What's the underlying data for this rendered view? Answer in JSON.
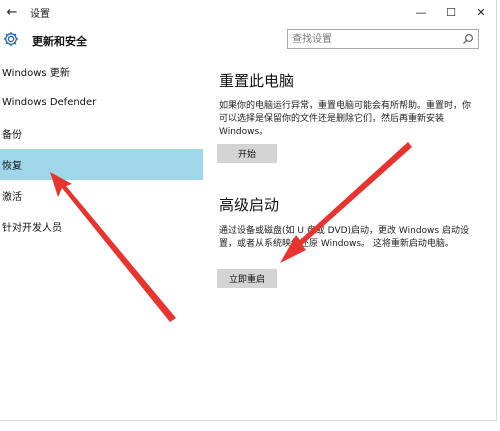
{
  "window": {
    "title": "设置",
    "back_glyph": "←",
    "minimize_glyph": "—",
    "maximize_glyph": "☐",
    "close_glyph": "✕"
  },
  "header": {
    "icon": "gear-icon",
    "title": "更新和安全"
  },
  "search": {
    "placeholder": "查找设置",
    "icon": "search-icon"
  },
  "sidebar": {
    "items": [
      {
        "label": "Windows 更新",
        "active": false
      },
      {
        "label": "Windows Defender",
        "active": false
      },
      {
        "label": "备份",
        "active": false
      },
      {
        "label": "恢复",
        "active": true
      },
      {
        "label": "激活",
        "active": false
      },
      {
        "label": "针对开发人员",
        "active": false
      }
    ]
  },
  "content": {
    "reset": {
      "title": "重置此电脑",
      "description": "如果你的电脑运行异常，重置电脑可能会有所帮助。重置时，你可以选择是保留你的文件还是删除它们，然后再重新安装 Windows。",
      "button": "开始"
    },
    "advanced": {
      "title": "高级启动",
      "description": "通过设备或磁盘(如 U 盘或 DVD)启动，更改 Windows 启动设置，或者从系统映像还原 Windows。 这将重新启动电脑。",
      "button": "立即重启"
    }
  },
  "colors": {
    "active_item_bg": "#9fd6ea",
    "button_bg": "#d4d4d4",
    "annotation_arrow": "#e8332e"
  }
}
